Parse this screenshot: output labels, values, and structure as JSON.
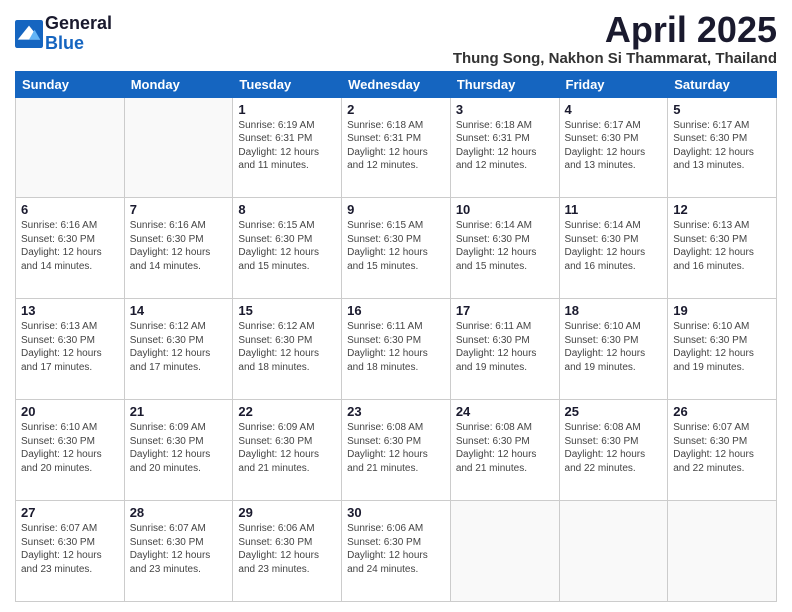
{
  "logo": {
    "general": "General",
    "blue": "Blue"
  },
  "title": "April 2025",
  "location": "Thung Song, Nakhon Si Thammarat, Thailand",
  "days_of_week": [
    "Sunday",
    "Monday",
    "Tuesday",
    "Wednesday",
    "Thursday",
    "Friday",
    "Saturday"
  ],
  "weeks": [
    [
      {
        "day": "",
        "info": ""
      },
      {
        "day": "",
        "info": ""
      },
      {
        "day": "1",
        "info": "Sunrise: 6:19 AM\nSunset: 6:31 PM\nDaylight: 12 hours and 11 minutes."
      },
      {
        "day": "2",
        "info": "Sunrise: 6:18 AM\nSunset: 6:31 PM\nDaylight: 12 hours and 12 minutes."
      },
      {
        "day": "3",
        "info": "Sunrise: 6:18 AM\nSunset: 6:31 PM\nDaylight: 12 hours and 12 minutes."
      },
      {
        "day": "4",
        "info": "Sunrise: 6:17 AM\nSunset: 6:30 PM\nDaylight: 12 hours and 13 minutes."
      },
      {
        "day": "5",
        "info": "Sunrise: 6:17 AM\nSunset: 6:30 PM\nDaylight: 12 hours and 13 minutes."
      }
    ],
    [
      {
        "day": "6",
        "info": "Sunrise: 6:16 AM\nSunset: 6:30 PM\nDaylight: 12 hours and 14 minutes."
      },
      {
        "day": "7",
        "info": "Sunrise: 6:16 AM\nSunset: 6:30 PM\nDaylight: 12 hours and 14 minutes."
      },
      {
        "day": "8",
        "info": "Sunrise: 6:15 AM\nSunset: 6:30 PM\nDaylight: 12 hours and 15 minutes."
      },
      {
        "day": "9",
        "info": "Sunrise: 6:15 AM\nSunset: 6:30 PM\nDaylight: 12 hours and 15 minutes."
      },
      {
        "day": "10",
        "info": "Sunrise: 6:14 AM\nSunset: 6:30 PM\nDaylight: 12 hours and 15 minutes."
      },
      {
        "day": "11",
        "info": "Sunrise: 6:14 AM\nSunset: 6:30 PM\nDaylight: 12 hours and 16 minutes."
      },
      {
        "day": "12",
        "info": "Sunrise: 6:13 AM\nSunset: 6:30 PM\nDaylight: 12 hours and 16 minutes."
      }
    ],
    [
      {
        "day": "13",
        "info": "Sunrise: 6:13 AM\nSunset: 6:30 PM\nDaylight: 12 hours and 17 minutes."
      },
      {
        "day": "14",
        "info": "Sunrise: 6:12 AM\nSunset: 6:30 PM\nDaylight: 12 hours and 17 minutes."
      },
      {
        "day": "15",
        "info": "Sunrise: 6:12 AM\nSunset: 6:30 PM\nDaylight: 12 hours and 18 minutes."
      },
      {
        "day": "16",
        "info": "Sunrise: 6:11 AM\nSunset: 6:30 PM\nDaylight: 12 hours and 18 minutes."
      },
      {
        "day": "17",
        "info": "Sunrise: 6:11 AM\nSunset: 6:30 PM\nDaylight: 12 hours and 19 minutes."
      },
      {
        "day": "18",
        "info": "Sunrise: 6:10 AM\nSunset: 6:30 PM\nDaylight: 12 hours and 19 minutes."
      },
      {
        "day": "19",
        "info": "Sunrise: 6:10 AM\nSunset: 6:30 PM\nDaylight: 12 hours and 19 minutes."
      }
    ],
    [
      {
        "day": "20",
        "info": "Sunrise: 6:10 AM\nSunset: 6:30 PM\nDaylight: 12 hours and 20 minutes."
      },
      {
        "day": "21",
        "info": "Sunrise: 6:09 AM\nSunset: 6:30 PM\nDaylight: 12 hours and 20 minutes."
      },
      {
        "day": "22",
        "info": "Sunrise: 6:09 AM\nSunset: 6:30 PM\nDaylight: 12 hours and 21 minutes."
      },
      {
        "day": "23",
        "info": "Sunrise: 6:08 AM\nSunset: 6:30 PM\nDaylight: 12 hours and 21 minutes."
      },
      {
        "day": "24",
        "info": "Sunrise: 6:08 AM\nSunset: 6:30 PM\nDaylight: 12 hours and 21 minutes."
      },
      {
        "day": "25",
        "info": "Sunrise: 6:08 AM\nSunset: 6:30 PM\nDaylight: 12 hours and 22 minutes."
      },
      {
        "day": "26",
        "info": "Sunrise: 6:07 AM\nSunset: 6:30 PM\nDaylight: 12 hours and 22 minutes."
      }
    ],
    [
      {
        "day": "27",
        "info": "Sunrise: 6:07 AM\nSunset: 6:30 PM\nDaylight: 12 hours and 23 minutes."
      },
      {
        "day": "28",
        "info": "Sunrise: 6:07 AM\nSunset: 6:30 PM\nDaylight: 12 hours and 23 minutes."
      },
      {
        "day": "29",
        "info": "Sunrise: 6:06 AM\nSunset: 6:30 PM\nDaylight: 12 hours and 23 minutes."
      },
      {
        "day": "30",
        "info": "Sunrise: 6:06 AM\nSunset: 6:30 PM\nDaylight: 12 hours and 24 minutes."
      },
      {
        "day": "",
        "info": ""
      },
      {
        "day": "",
        "info": ""
      },
      {
        "day": "",
        "info": ""
      }
    ]
  ]
}
